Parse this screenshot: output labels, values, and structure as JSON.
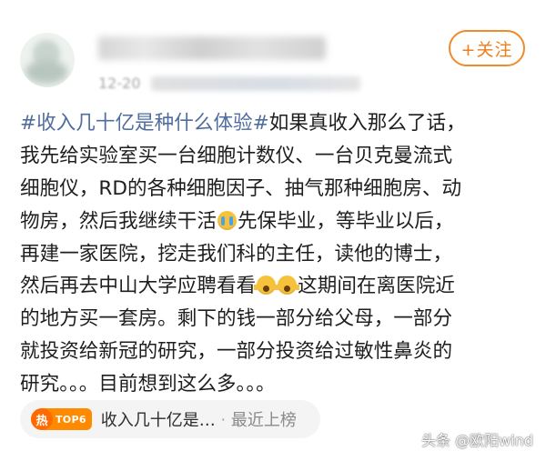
{
  "header": {
    "follow_label": "+关注",
    "time_text": "12-20"
  },
  "post": {
    "hashtag": "#收入几十亿是种什么体验#",
    "lines": [
      "如果真收入那么了话，",
      "我先给实验室买一台细胞计数仪、一台贝克曼流式",
      "细胞仪，RD的各种细胞因子、抽气那种细胞房、动",
      "物房，然后我继续干活",
      "先保毕业，等毕业以后，",
      "再建一家医院，挖走我们科的主任，读他的博士，",
      "然后再去中山大学应聘看看",
      "这期间在离医院近",
      "的地方买一套房。剩下的钱一部分给父母，一部分",
      "就投资给新冠的研究，一部分投资给过敏性鼻炎的",
      "研究。。。目前想到这么多。。。"
    ],
    "emojis": [
      "crying-face-emoji",
      "screaming-face-emoji"
    ]
  },
  "trend": {
    "hot_icon": "热",
    "rank": "TOP6",
    "title": "收入几十亿是…",
    "separator": "·",
    "subtitle": "最近上榜"
  },
  "watermark": {
    "text": "头条 @欧阳wind"
  },
  "colors": {
    "accent_orange": "#ef7e1a",
    "hashtag_blue": "#4f6d9e",
    "trend_badge": "#ff8a00"
  }
}
